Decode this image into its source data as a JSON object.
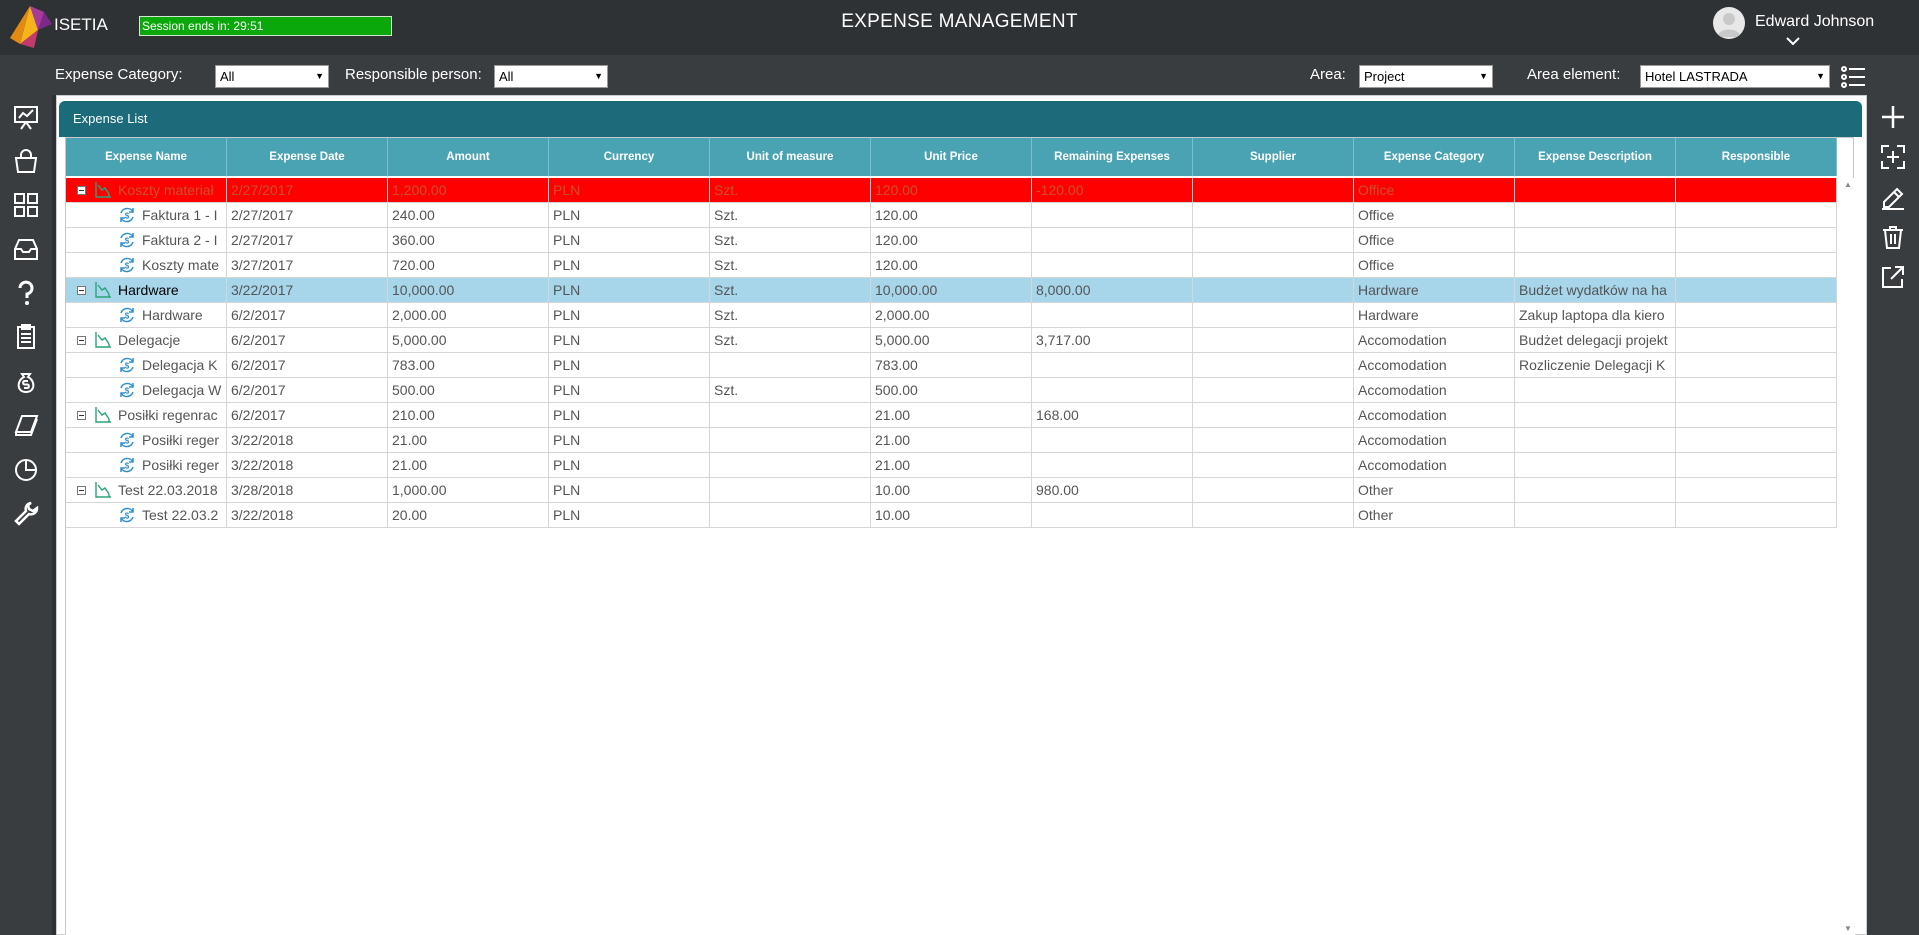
{
  "header": {
    "brand": "ISETIA",
    "session": "Session ends in: 29:51",
    "title": "EXPENSE MANAGEMENT",
    "user_name": "Edward Johnson"
  },
  "filters": {
    "category_label": "Expense Category:",
    "category_value": "All",
    "responsible_label": "Responsible person:",
    "responsible_value": "All",
    "area_label": "Area:",
    "area_value": "Project",
    "area_element_label": "Area element:",
    "area_element_value": "Hotel LASTRADA"
  },
  "panel": {
    "title": "Expense List"
  },
  "columns": [
    "Expense Name",
    "Expense Date",
    "Amount",
    "Currency",
    "Unit of measure",
    "Unit Price",
    "Remaining Expenses",
    "Supplier",
    "Expense Category",
    "Expense Description",
    "Responsible"
  ],
  "rows": [
    {
      "level": 0,
      "state": "red",
      "cells": [
        "Koszty materiał",
        "2/27/2017",
        "1,200.00",
        "PLN",
        "Szt.",
        "120.00",
        "-120.00",
        "",
        "Office",
        "",
        ""
      ]
    },
    {
      "level": 1,
      "state": "",
      "cells": [
        "Faktura 1 - I",
        "2/27/2017",
        "240.00",
        "PLN",
        "Szt.",
        "120.00",
        "",
        "",
        "Office",
        "",
        ""
      ]
    },
    {
      "level": 1,
      "state": "",
      "cells": [
        "Faktura 2 - I",
        "2/27/2017",
        "360.00",
        "PLN",
        "Szt.",
        "120.00",
        "",
        "",
        "Office",
        "",
        ""
      ]
    },
    {
      "level": 1,
      "state": "",
      "cells": [
        "Koszty mate",
        "3/27/2017",
        "720.00",
        "PLN",
        "Szt.",
        "120.00",
        "",
        "",
        "Office",
        "",
        ""
      ]
    },
    {
      "level": 0,
      "state": "sel",
      "cells": [
        "Hardware",
        "3/22/2017",
        "10,000.00",
        "PLN",
        "Szt.",
        "10,000.00",
        "8,000.00",
        "",
        "Hardware",
        "Budżet wydatków na ha",
        ""
      ]
    },
    {
      "level": 1,
      "state": "",
      "cells": [
        "Hardware",
        "6/2/2017",
        "2,000.00",
        "PLN",
        "Szt.",
        "2,000.00",
        "",
        "",
        "Hardware",
        "Zakup laptopa dla kiero",
        ""
      ]
    },
    {
      "level": 0,
      "state": "",
      "cells": [
        "Delegacje",
        "6/2/2017",
        "5,000.00",
        "PLN",
        "Szt.",
        "5,000.00",
        "3,717.00",
        "",
        "Accomodation",
        "Budżet delegacji projekt",
        ""
      ]
    },
    {
      "level": 1,
      "state": "",
      "cells": [
        "Delegacja K",
        "6/2/2017",
        "783.00",
        "PLN",
        "",
        "783.00",
        "",
        "",
        "Accomodation",
        "Rozliczenie Delegacji K",
        ""
      ]
    },
    {
      "level": 1,
      "state": "",
      "cells": [
        "Delegacja W",
        "6/2/2017",
        "500.00",
        "PLN",
        "Szt.",
        "500.00",
        "",
        "",
        "Accomodation",
        "",
        ""
      ]
    },
    {
      "level": 0,
      "state": "",
      "cells": [
        "Posiłki regenrac",
        "6/2/2017",
        "210.00",
        "PLN",
        "",
        "21.00",
        "168.00",
        "",
        "Accomodation",
        "",
        ""
      ]
    },
    {
      "level": 1,
      "state": "",
      "cells": [
        "Posiłki reger",
        "3/22/2018",
        "21.00",
        "PLN",
        "",
        "21.00",
        "",
        "",
        "Accomodation",
        "",
        ""
      ]
    },
    {
      "level": 1,
      "state": "",
      "cells": [
        "Posiłki reger",
        "3/22/2018",
        "21.00",
        "PLN",
        "",
        "21.00",
        "",
        "",
        "Accomodation",
        "",
        ""
      ]
    },
    {
      "level": 0,
      "state": "",
      "cells": [
        "Test 22.03.2018",
        "3/28/2018",
        "1,000.00",
        "PLN",
        "",
        "10.00",
        "980.00",
        "",
        "Other",
        "",
        ""
      ]
    },
    {
      "level": 1,
      "state": "",
      "cells": [
        "Test 22.03.2",
        "3/22/2018",
        "20.00",
        "PLN",
        "",
        "10.00",
        "",
        "",
        "Other",
        "",
        ""
      ]
    }
  ],
  "colors": {
    "header_bg": "#2f3235",
    "panel_header": "#1b6b7a",
    "grid_header": "#4aa3b2",
    "session_green": "#0aa80a",
    "row_over_budget": "#ff0000",
    "row_selected": "#a7d5ea"
  }
}
